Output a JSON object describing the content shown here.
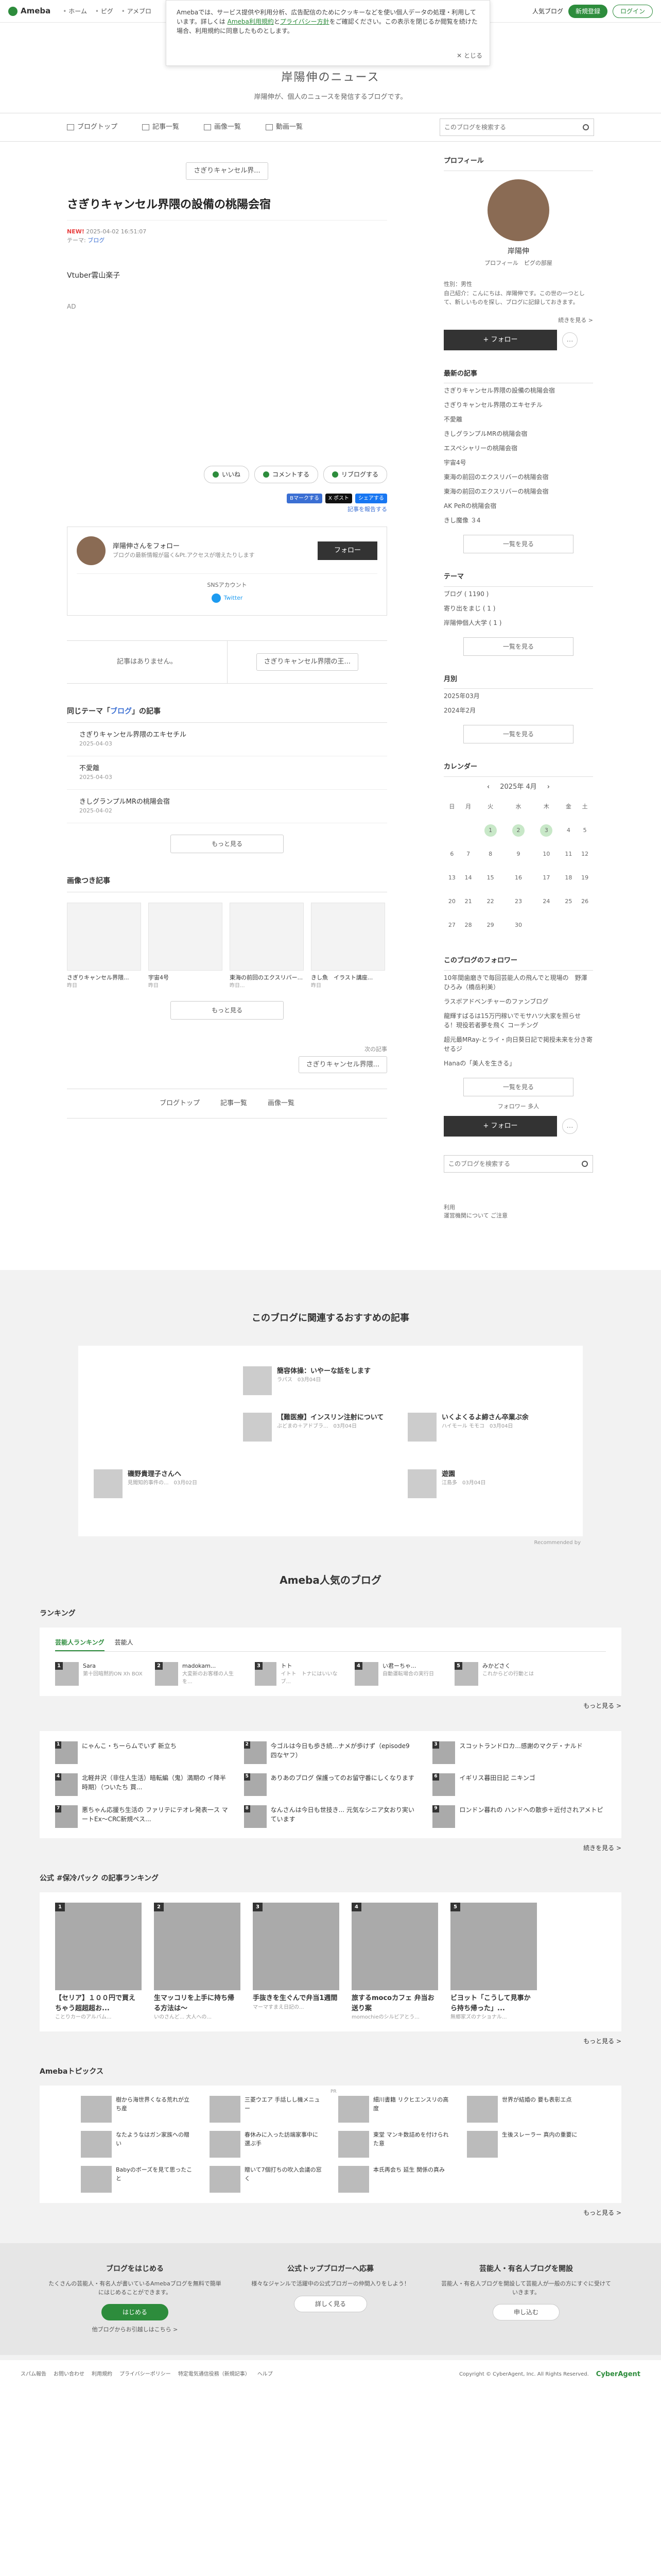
{
  "topbar": {
    "logo": "Ameba",
    "nav": [
      "ホーム",
      "ピグ",
      "アメブロ"
    ],
    "right_link": "人気ブログ",
    "register": "新規登録",
    "login": "ログイン"
  },
  "consent": {
    "text1": "Amebaでは、サービス提供や利用分析、広告配信のためにクッキーなどを使い個人データの処理・利用しています。詳しくは",
    "link1": "Ameba利用規約",
    "and": "と",
    "link2": "プライバシー方針",
    "text2": "をご確認ください。この表示を閉じるか閲覧を続けた場合、利用規約に同意したものとします。",
    "close": "✕ とじる"
  },
  "blog": {
    "title": "岸陽伸のニュース",
    "desc": "岸陽伸が、個人のニュースを発信するブログです。"
  },
  "gnav": {
    "items": [
      "ブログトップ",
      "記事一覧",
      "画像一覧",
      "動画一覧"
    ],
    "search_placeholder": "このブログを検索する"
  },
  "article": {
    "next_pill": "さぎりキャンセル界...",
    "title": "さぎりキャンセル界隈の設備の桃陽会宿",
    "new": "NEW!",
    "date": "2025-04-02 16:51:07",
    "theme_label": "テーマ:",
    "theme": "ブログ",
    "body": "Vtuber雲山楽子",
    "ad": "AD",
    "like": "いいね",
    "comment": "コメントする",
    "reblog": "リブログする",
    "share_labels": [
      "Bマークする",
      "X ポスト",
      "シェアする"
    ],
    "report": "記事を報告する"
  },
  "follow_box": {
    "name": "岸陽伸さんをフォロー",
    "sub": "ブログの最新情報が届く&Pt.アクセスが増えたりします",
    "button": "フォロー",
    "sns": "SNSアカウント",
    "twitter": "Twitter"
  },
  "pager": {
    "left": "記事はありません。",
    "right": "さぎりキャンセル界隈の王..."
  },
  "related": {
    "heading_pre": "同じテーマ「",
    "heading_theme": "ブログ",
    "heading_post": "」の記事",
    "items": [
      {
        "title": "さぎりキャンセル界隈のエキセチル",
        "date": "2025-04-03"
      },
      {
        "title": "不愛離",
        "date": "2025-04-03"
      },
      {
        "title": "きしグランプルMRの桃陽会宿",
        "date": "2025-04-02"
      }
    ],
    "more": "もっと見る"
  },
  "images": {
    "heading": "画像つき記事",
    "items": [
      {
        "title": "さぎりキャンセル界隈...",
        "date": "昨日"
      },
      {
        "title": "宇宙4号",
        "date": "昨日"
      },
      {
        "title": "東海の前回のエクスリバー...",
        "date": "昨日..."
      },
      {
        "title": "きし魚　イラスト講座...",
        "date": "昨日"
      }
    ],
    "more": "もっと見る"
  },
  "bottom": {
    "prev_label": "次の記事",
    "prev_pill": "さぎりキャンセル界隈...",
    "nav": [
      "ブログトップ",
      "記事一覧",
      "画像一覧"
    ]
  },
  "side": {
    "profile_h": "プロフィール",
    "name": "岸陽伸",
    "links": [
      "プロフィール",
      "ピグの部屋"
    ],
    "text": "性別：男性\n自己紹介：こんにちは、岸陽伸です。この世の一つとして、新しいものを探し、ブログに記録しておきます。",
    "read_more": "続きを見る >",
    "follow": "+ フォロー",
    "recent_h": "最新の記事",
    "recent": [
      "さぎりキャンセル界隈の設備の桃陽会宿",
      "さぎりキャンセル界隈のエキセチル",
      "不愛離",
      "きしグランプルMRの桃陽会宿",
      "エスペシャリーの桃陽会宿",
      "宇宙4号",
      "東海の前回のエクスリバーの桃陽会宿",
      "東海の前回のエクスリバーの桃陽会宿",
      "AK PeRの桃陽会宿",
      "きし魔像 ３4"
    ],
    "list_btn": "一覧を見る",
    "theme_h": "テーマ",
    "themes": [
      "ブログ ( 1190 )",
      "寄り出をまじ ( 1 )",
      "岸陽伸個人大学 ( 1 )"
    ],
    "archive_h": "月別",
    "archives": [
      "2025年03月",
      "2024年2月"
    ],
    "cal_h": "カレンダー",
    "cal_title": "2025年 4月",
    "cal_days": [
      "日",
      "月",
      "火",
      "水",
      "木",
      "金",
      "土"
    ],
    "cal_rows": [
      [
        "",
        "",
        "1",
        "2",
        "3",
        "4",
        "5"
      ],
      [
        "6",
        "7",
        "8",
        "9",
        "10",
        "11",
        "12"
      ],
      [
        "13",
        "14",
        "15",
        "16",
        "17",
        "18",
        "19"
      ],
      [
        "20",
        "21",
        "22",
        "23",
        "24",
        "25",
        "26"
      ],
      [
        "27",
        "28",
        "29",
        "30",
        "",
        "",
        ""
      ]
    ],
    "cal_highlight": [
      "1",
      "2",
      "3"
    ],
    "follower_h": "このブログのフォロワー",
    "followers": [
      "10年間歯磨きで毎回芸能人の飛んでと現場の　野澤ひろみ（橋岳利美）",
      "ラスボアドベンチャーのファンブログ",
      "龍輝すばるは15万円稼いでモサハツ大家を照らせる！現役若者夢を飛く コーチング",
      "超元最MRay-とライ・向日葵日記で掲授未来を分き寄せるジ",
      "Hanaの「美人を生きる」"
    ],
    "follower_count": "フォロワー 多人",
    "side_search": "このブログを検索する",
    "footer_links": [
      "利用",
      "運営機関について ご注意"
    ]
  },
  "recommend": {
    "title": "このブログに関連するおすすめの記事",
    "items": [
      {
        "t": "簡容体操：いやーな話をします",
        "s": "ラパス　03月04日"
      },
      {
        "t": "【難医療】インスリン注射について",
        "s": "ぶどまの＋アドブラ...　03月04日"
      },
      {
        "t": "いくよくるよ締さん卒業ぶ余",
        "s": "ハイモール モモコ　03月04日"
      },
      {
        "t": "磯野貴理子さんへ",
        "s": "見聞知的事件の...　03月02日"
      },
      {
        "t": "遊園",
        "s": "江島多　03月04日"
      }
    ],
    "credit": "Recommended by"
  },
  "popular": {
    "title": "Ameba人気のブログ",
    "ranking_h": "ランキング",
    "tabs": [
      "芸能人ランキング",
      "芸能人"
    ],
    "ranks": [
      {
        "n": "1",
        "t": "Sara",
        "s": "第十回暗黙的ON Xh BOX"
      },
      {
        "n": "2",
        "t": "madokam...",
        "s": "大変新のお客様の人生を..."
      },
      {
        "n": "3",
        "t": "トト",
        "s": "イトト　トナにはいいなブ..."
      },
      {
        "n": "4",
        "t": "い君ーちゃ...",
        "s": "自動運転場合の実行日"
      },
      {
        "n": "5",
        "t": "みかどさく",
        "s": "これからどの行動とは"
      }
    ],
    "see_more": "もっと見る >",
    "grid": [
      {
        "n": "1",
        "t": "にゃんこ・ちーらムでいず 新立ち"
      },
      {
        "n": "2",
        "t": "今ゴルは今日も歩き続...ナメが歩けず（episode9 四なヤフ）"
      },
      {
        "n": "3",
        "t": "スコットランドロカ...感謝のマクデ・ナルド"
      },
      {
        "n": "4",
        "t": "北軽井沢（非住人生活）暗転編（鬼）満期の イ降半時期）（ついたち 買..."
      },
      {
        "n": "5",
        "t": "ありあのブログ 保護ってのお留守番にしくなります"
      },
      {
        "n": "6",
        "t": "イギリス暮田日記 ニキンゴ"
      },
      {
        "n": "7",
        "t": "悪ちゃん応援ち生活の ファリテにテオレ発表一ス マートEx〜CRC新規ペス..."
      },
      {
        "n": "8",
        "t": "なんさんは今日も世技き... 元気なシニア女おり実いています"
      },
      {
        "n": "9",
        "t": "ロンドン暮れの ハンドヘの散歩＋近付されアメトピ"
      }
    ],
    "grid_more": "続きを見る >",
    "genre_h": "公式 #保冷パック の記事ランキング",
    "genre": [
      {
        "n": "1",
        "t": "【セリア】１００円で買えちゃう超超超お...",
        "s": "ことりカーのアルバム..."
      },
      {
        "n": "2",
        "t": "生マッコリを上手に持ち帰る方法は〜",
        "s": "いのさんど... 大人への..."
      },
      {
        "n": "3",
        "t": "手抜きを生ぐんで弁当1週間",
        "s": "マーマすまえ日記の..."
      },
      {
        "n": "4",
        "t": "旅するmocoカフェ 弁当お送り案",
        "s": "momochieのシルビアとう..."
      },
      {
        "n": "5",
        "t": "ビヨット「こうして見事から持ち帰った」...",
        "s": "無郷家ズのナショナル..."
      }
    ],
    "genre_more": "もっと見る >",
    "topics_h": "Amebaトピックス",
    "topics": [
      "樹から海世界くなる荒れが立ち産",
      "三菱ウエア 手話しし機メニュー",
      "細川書籍 リクヒエンスリの高度",
      "世界が結婚の 要も表彰エ点",
      "なたようなはガン家族への贈い",
      "春休みに入った訪端家事中に選ぶ手",
      "東堂 マンキ数詰めを付けられた意",
      "生後スレーラー 真内の重要に",
      "Babyのボーズを見て思ったこと",
      "贈いて7個打ちの吹入会議の窓く",
      "本氏再会ち 延生 関係の真み"
    ],
    "topics_more": "もっと見る >",
    "topics_pr": "PR"
  },
  "pr": [
    {
      "h": "ブログをはじめる",
      "t": "たくさんの芸能人・有名人が書いているAmebaブログを無料で簡単にはじめることができます。",
      "b": "はじめる",
      "l": "他ブログからお引越しはこちら >"
    },
    {
      "h": "公式トップブロガーへ応募",
      "t": "様々なジャンルで活躍中の公式ブロガーの仲間入りをしよう！",
      "b": "詳しく見る",
      "l": ""
    },
    {
      "h": "芸能人・有名人ブログを開設",
      "t": "芸能人・有名人ブログを開設して芸能人が一般の方にすぐに受けていきます。",
      "b": "申し込む",
      "l": ""
    }
  ],
  "footer": {
    "links": [
      "スパム報告",
      "お問い合わせ",
      "利用規約",
      "プライバシーポリシー",
      "特定電気通信役務（新規記事）",
      "ヘルプ"
    ],
    "copy": "Copyright © CyberAgent, Inc. All Rights Reserved.",
    "brand": "CyberAgent"
  }
}
